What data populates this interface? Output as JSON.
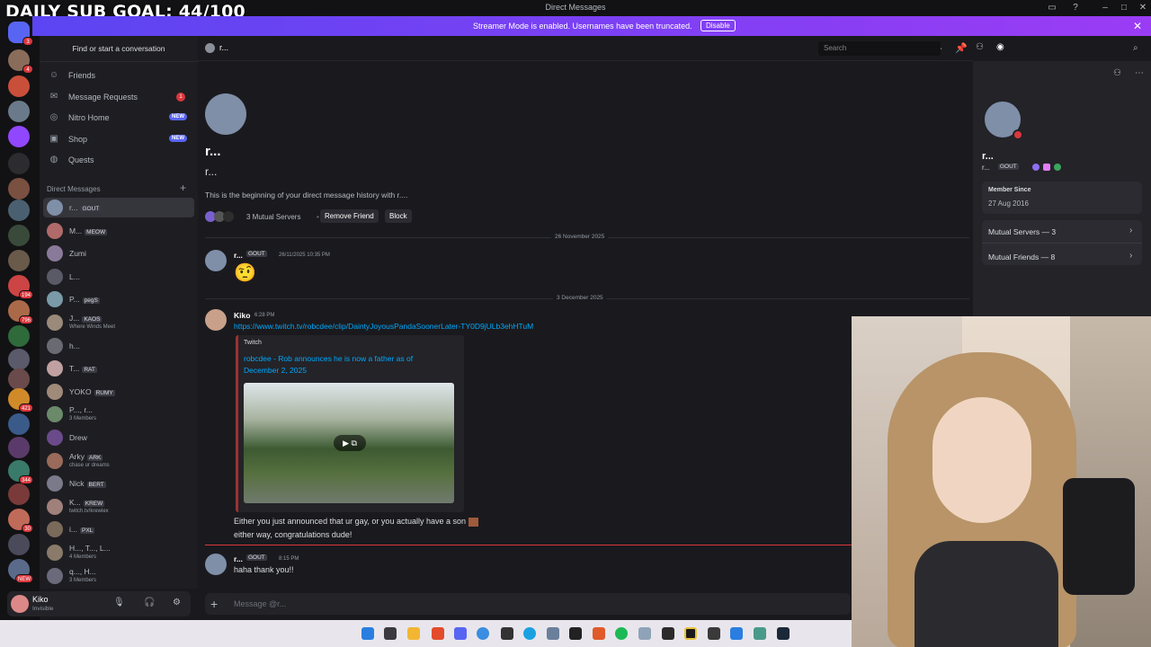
{
  "window": {
    "title": "Direct Messages",
    "overlay_goal": "DAILY SUB GOAL: 44/100"
  },
  "banner": {
    "text": "Streamer Mode is enabled. Usernames have been truncated.",
    "button": "Disable",
    "accent": "#5865f2"
  },
  "server_rail": {
    "badges": [
      "3",
      "4",
      "",
      "",
      "",
      "",
      "",
      "",
      "",
      "",
      "194",
      "796",
      "",
      "",
      "",
      "421",
      "",
      "",
      "344",
      "",
      "30",
      "",
      "NEW"
    ]
  },
  "sidebar": {
    "search_placeholder": "Find or start a conversation",
    "nav": [
      {
        "label": "Friends",
        "icon": "friends-icon"
      },
      {
        "label": "Message Requests",
        "icon": "mail-icon",
        "count": "1"
      },
      {
        "label": "Nitro Home",
        "icon": "nitro-icon",
        "badge": "NEW"
      },
      {
        "label": "Shop",
        "icon": "shop-icon",
        "badge": "NEW"
      },
      {
        "label": "Quests",
        "icon": "quests-icon"
      }
    ],
    "dm_header": "Direct Messages",
    "dms": [
      {
        "name": "r...",
        "tag": "GOUT",
        "sub": ""
      },
      {
        "name": "M...",
        "tag": "MEOW",
        "sub": ""
      },
      {
        "name": "Zumi",
        "tag": "",
        "sub": ""
      },
      {
        "name": "L...",
        "tag": "",
        "sub": ""
      },
      {
        "name": "P...",
        "tag": "pegS",
        "sub": ""
      },
      {
        "name": "J...",
        "tag": "KAOS",
        "sub": "Where Winds Meet"
      },
      {
        "name": "h...",
        "tag": "",
        "sub": ""
      },
      {
        "name": "T...",
        "tag": "RAT",
        "sub": ""
      },
      {
        "name": "YOKO",
        "tag": "RUMY",
        "sub": ""
      },
      {
        "name": "P..., r...",
        "tag": "",
        "sub": "3 Members"
      },
      {
        "name": "Drew",
        "tag": "",
        "sub": ""
      },
      {
        "name": "Arky",
        "tag": "ARK",
        "sub": "chase ur dreams"
      },
      {
        "name": "Nick",
        "tag": "BERT",
        "sub": ""
      },
      {
        "name": "K...",
        "tag": "KREW",
        "sub": "twitch.tv/krewlex"
      },
      {
        "name": "i...",
        "tag": "PXL",
        "sub": ""
      },
      {
        "name": "H..., T..., L...",
        "tag": "",
        "sub": "4 Members"
      },
      {
        "name": "q..., H...",
        "tag": "",
        "sub": "3 Members"
      }
    ]
  },
  "user_panel": {
    "name": "Kiko",
    "status": "Invisible"
  },
  "chat": {
    "header_name": "r...",
    "search_placeholder": "Search",
    "intro": {
      "title": "r...",
      "subtitle": "r...",
      "text": "This is the beginning of your direct message history with r....",
      "mutual": "3 Mutual Servers",
      "remove_friend": "Remove Friend",
      "block": "Block"
    },
    "date1": "26 November 2025",
    "msg1": {
      "name": "r...",
      "tag": "GOUT",
      "time": "26/11/2025 10:35 PM",
      "emoji": "🤨"
    },
    "date2": "3 December 2025",
    "msg2": {
      "name": "Kiko",
      "time": "6:28 PM",
      "link": "https://www.twitch.tv/robcdee/clip/DaintyJoyousPandaSoonerLater-TY0D9jULb3ehHTuM",
      "embed_provider": "Twitch",
      "embed_title": "robcdee - Rob announces he is now a father as of December 2, 2025",
      "line1": "Either you just announced that ur gay, or you actually have a son",
      "line2": "either way, congratulations dude!"
    },
    "msg3": {
      "name": "r...",
      "tag": "GOUT",
      "time": "8:15 PM",
      "text": "haha thank you!!"
    },
    "composer_placeholder": "Message @r..."
  },
  "profile": {
    "name": "r...",
    "sub": "r...",
    "tag": "GOUT",
    "member_since_label": "Member Since",
    "member_since": "27 Aug 2016",
    "mutual_servers": "Mutual Servers — 3",
    "mutual_friends": "Mutual Friends — 8"
  }
}
